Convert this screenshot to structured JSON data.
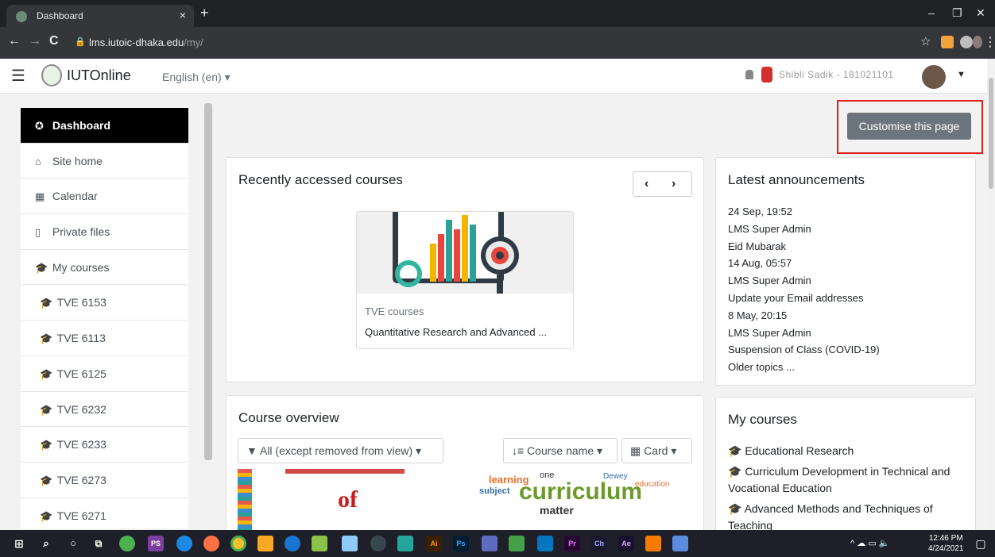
{
  "browser": {
    "tab_title": "Dashboard",
    "tab_close": "×",
    "new_tab": "+",
    "url_host": "lms.iutoic-dhaka.edu",
    "url_path": "/my/",
    "win_minimize": "–",
    "win_restore": "❐",
    "win_close": "✕",
    "back": "←",
    "forward": "→",
    "reload": "C",
    "star": "☆",
    "menu": "⋮"
  },
  "navbar": {
    "hamburger": "☰",
    "brand": "IUTOnline",
    "language": "English (en) ▾",
    "user_name": "Shibli Sadik - 181021101",
    "caret": "▼"
  },
  "drawer": {
    "items": [
      {
        "icon": "✪",
        "label": "Dashboard"
      },
      {
        "icon": "⌂",
        "label": "Site home"
      },
      {
        "icon": "▦",
        "label": "Calendar"
      },
      {
        "icon": "▯",
        "label": "Private files"
      },
      {
        "icon": "🎓",
        "label": "My courses"
      }
    ],
    "courses": [
      {
        "icon": "🎓",
        "label": "TVE 6153"
      },
      {
        "icon": "🎓",
        "label": "TVE 6113"
      },
      {
        "icon": "🎓",
        "label": "TVE 6125"
      },
      {
        "icon": "🎓",
        "label": "TVE 6232"
      },
      {
        "icon": "🎓",
        "label": "TVE 6233"
      },
      {
        "icon": "🎓",
        "label": "TVE 6273"
      },
      {
        "icon": "🎓",
        "label": "TVE 6271"
      }
    ]
  },
  "main": {
    "customise_label": "Customise this page",
    "recent": {
      "title": "Recently accessed courses",
      "prev": "‹",
      "next": "›",
      "course_category": "TVE courses",
      "course_name": "Quantitative Research and Advanced ..."
    },
    "announcements": {
      "title": "Latest announcements",
      "lines": [
        "24 Sep, 19:52",
        "LMS Super Admin",
        "Eid Mubarak",
        "14 Aug, 05:57",
        "LMS Super Admin",
        "Update your Email addresses",
        "8 May, 20:15",
        "LMS Super Admin",
        "Suspension of Class (COVID-19)",
        "Older topics ..."
      ]
    },
    "overview": {
      "title": "Course overview",
      "filter_label": "▼ All (except removed from view) ▾",
      "sort_label": "↓≡ Course name ▾",
      "view_label": "▦ Card ▾",
      "thumb1_text": "of",
      "thumb2_text": "curriculum"
    },
    "my_courses": {
      "title": "My courses",
      "items": [
        "Educational Research",
        "Curriculum Development in Technical and Vocational Education",
        "Advanced Methods and Techniques of Teaching"
      ]
    }
  },
  "taskbar": {
    "time": "12:46 PM",
    "date": "4/24/2021",
    "apps": [
      "PS",
      "Ai",
      "Ps",
      "Pr",
      "Ch",
      "Ae"
    ]
  },
  "colors": {
    "accent_red": "#e0201c",
    "button_gray": "#6c757d",
    "drawer_active": "#000000"
  }
}
